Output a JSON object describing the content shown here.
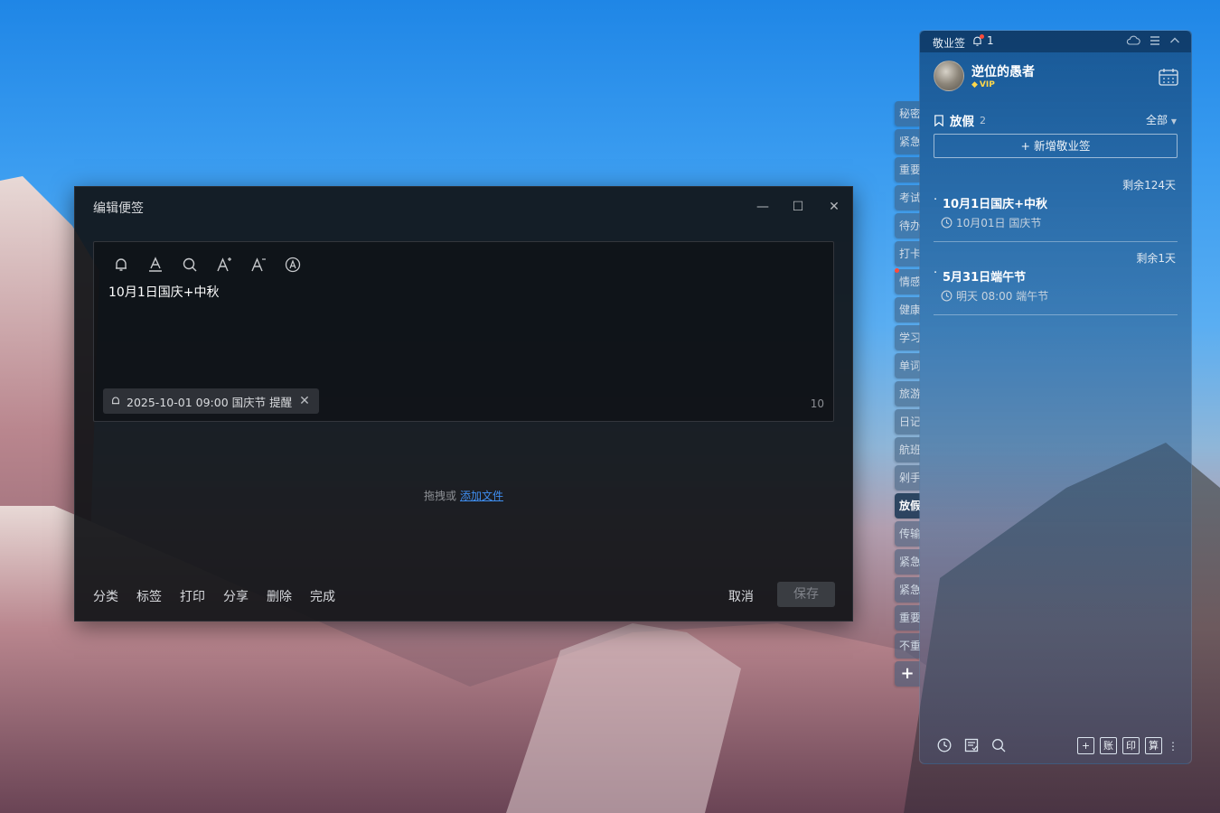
{
  "editor": {
    "title": "编辑便签",
    "text": "10月1日国庆+中秋",
    "reminder": "2025-10-01 09:00 国庆节 提醒",
    "char_count": "10",
    "drop_prefix": "拖拽或",
    "drop_link": "添加文件",
    "actions": [
      "分类",
      "标签",
      "打印",
      "分享",
      "删除",
      "完成"
    ],
    "cancel": "取消",
    "save": "保存"
  },
  "side_tabs": [
    "秘密",
    "紧急",
    "重要",
    "考试",
    "待办",
    "打卡",
    "情感",
    "健康",
    "学习",
    "单词",
    "旅游",
    "日记",
    "航班",
    "剁手",
    "放假",
    "传输",
    "紧急",
    "紧急",
    "重要",
    "不重",
    "+"
  ],
  "side_tab_active_index": 14,
  "panel": {
    "app_name": "敬业签",
    "notification_count": "1",
    "username": "逆位的愚者",
    "vip": "VIP",
    "category": "放假",
    "category_count": "2",
    "filter": "全部",
    "add_note": "新增敬业签",
    "notes": [
      {
        "remain": "剩余124天",
        "title": "10月1日国庆+中秋",
        "meta": "10月01日 国庆节"
      },
      {
        "remain": "剩余1天",
        "title": "5月31日端午节",
        "meta": "明天 08:00 端午节"
      }
    ],
    "footer_buttons": [
      "账",
      "印",
      "算"
    ]
  },
  "colors": {
    "accent_link": "#3f8ef0",
    "notification_dot": "#ff4b3a",
    "vip": "#ffd84a"
  }
}
